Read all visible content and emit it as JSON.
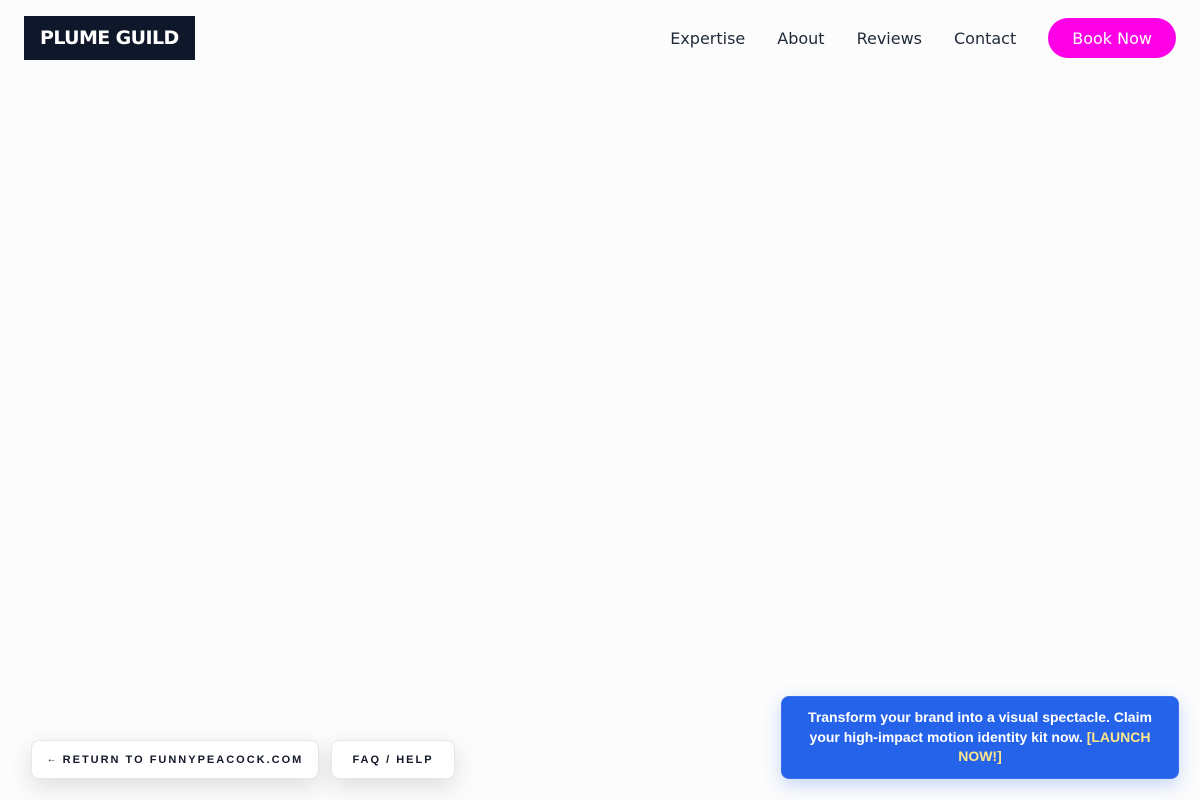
{
  "header": {
    "logo_text": "PLUME GUILD",
    "nav": [
      {
        "label": "Expertise"
      },
      {
        "label": "About"
      },
      {
        "label": "Reviews"
      },
      {
        "label": "Contact"
      }
    ],
    "cta_label": "Book Now"
  },
  "footer_buttons": {
    "return_arrow": "←",
    "return_label": "RETURN TO FUNNYPEACOCK.COM",
    "faq_label": "FAQ / HELP"
  },
  "promo": {
    "text": "Transform your brand into a visual spectacle. Claim your high-impact motion identity kit now. ",
    "link_text": "[LAUNCH NOW!]"
  },
  "colors": {
    "background": "#fcfcfc",
    "logo_bg": "#0f172a",
    "cta_bg": "#ff00e6",
    "promo_bg": "#2563eb",
    "promo_link": "#fde68a"
  }
}
